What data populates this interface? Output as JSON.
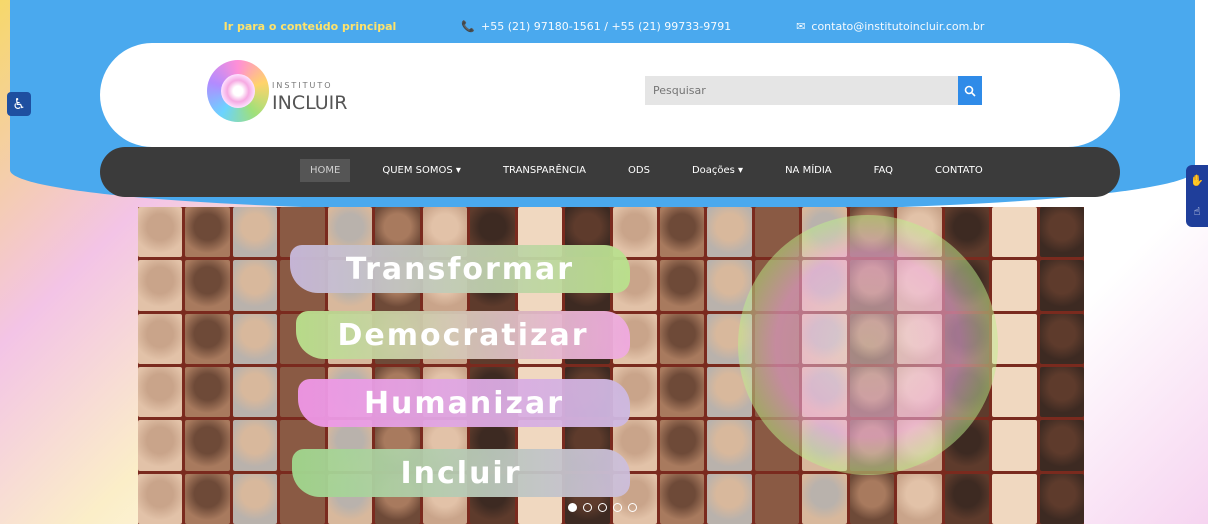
{
  "topbar": {
    "skip_link": "Ir para o conteúdo principal",
    "phone": "+55 (21) 97180-1561 / +55 (21) 99733-9791",
    "email": "contato@institutoincluir.com.br"
  },
  "header": {
    "logo_small": "INSTITUTO",
    "logo_name": "INCLUIR",
    "search_placeholder": "Pesquisar"
  },
  "nav": {
    "items": [
      {
        "label": "HOME"
      },
      {
        "label": "QUEM SOMOS ▾"
      },
      {
        "label": "TRANSPARÊNCIA"
      },
      {
        "label": "ODS"
      },
      {
        "label": "Doações ▾"
      },
      {
        "label": "NA MÍDIA"
      },
      {
        "label": "FAQ"
      },
      {
        "label": "CONTATO"
      }
    ]
  },
  "hero": {
    "words": [
      "Transformar",
      "Democratizar",
      "Humanizar",
      "Incluir"
    ]
  },
  "colors": {
    "blue": "#4aa9ee",
    "nav_bg": "#3b3b3b",
    "accent": "#2f8be8"
  },
  "icons": {
    "phone": "phone-icon",
    "email": "envelope-icon",
    "search": "search-icon",
    "accessibility": "accessibility-icon",
    "vlibras": "sign-language-icon"
  }
}
